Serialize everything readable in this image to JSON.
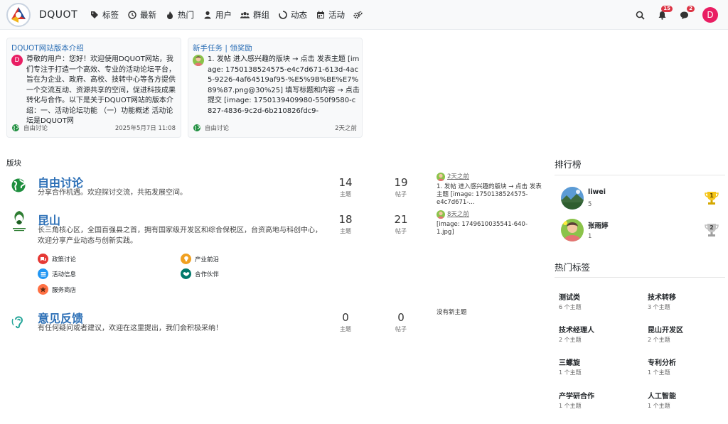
{
  "brand": {
    "name": "DQUOT"
  },
  "nav": {
    "items": [
      {
        "label": "标签",
        "icon": "tags-icon"
      },
      {
        "label": "最新",
        "icon": "clock-icon"
      },
      {
        "label": "热门",
        "icon": "fire-icon"
      },
      {
        "label": "用户",
        "icon": "user-icon"
      },
      {
        "label": "群组",
        "icon": "users-icon"
      },
      {
        "label": "动态",
        "icon": "circle-notch-icon"
      },
      {
        "label": "活动",
        "icon": "calendar-icon"
      },
      {
        "label": "",
        "icon": "cogs-icon"
      }
    ],
    "notifications_count": "15",
    "chat_count": "2",
    "user_initial": "D"
  },
  "cards": [
    {
      "title": "DQUOT网站版本介绍",
      "avatar_initial": "D",
      "text": "尊敬的用户：您好！欢迎使用DQUOT网站，我们专注于打造一个高效、专业的活动论坛平台，旨在为企业、政府、高校、技转中心等各方提供一个交流互动、资源共享的空间，促进科技成果转化与合作。以下是关于DQUOT网站的版本介绍：一、活动论坛功能 （一）功能概述 活动论坛是DQUOT网",
      "category": "自由讨论",
      "time": "2025年5月7日 11:08"
    },
    {
      "title": "新手任务 | 领奖励",
      "text": "1. 发帖 进入感兴趣的版块 → 点击 发表主题 [image: 1750138524575-e4c7d671-613d-4ac5-9226-4af64519af95-%E5%9B%BE%E7%89%87.png@30%25] 填写标题和内容 → 点击 提交 [image: 1750139409980-550f9580-c827-4836-9c2d-6b210826fdc9-",
      "category": "自由讨论",
      "time": "2天之前"
    }
  ],
  "categories_label": "版块",
  "categories": [
    {
      "name": "自由讨论",
      "desc": "分享合作机遇。欢迎探讨交流，共拓发展空间。",
      "topics": "14",
      "posts": "19",
      "topics_label": "主题",
      "posts_label": "帖子",
      "latest_time": "2天之前",
      "latest_text": "1. 发帖 进入感兴趣的版块 → 点击 发表主题 [image: 1750138524575-e4c7d671-..."
    },
    {
      "name": "昆山",
      "desc": "长三角核心区，全国百强县之首，拥有国家级开发区和综合保税区，台资高地与科创中心，欢迎分享产业动态与创新实践。",
      "topics": "18",
      "posts": "21",
      "topics_label": "主题",
      "posts_label": "帖子",
      "latest_time": "8天之前",
      "latest_text": "[image: 1749610035541-640-1.jpg]",
      "subcategories": [
        {
          "label": "政策讨论",
          "color": "#e53935"
        },
        {
          "label": "产业前沿",
          "color": "#f0a020"
        },
        {
          "label": "活动信息",
          "color": "#2196f3"
        },
        {
          "label": "合作伙伴",
          "color": "#00796b"
        },
        {
          "label": "服务商店",
          "color": "#ff7043"
        }
      ]
    },
    {
      "name": "意见反馈",
      "desc": "有任何疑问或者建议，欢迎在这里提出，我们会积极采纳！",
      "topics": "0",
      "posts": "0",
      "topics_label": "主题",
      "posts_label": "帖子",
      "latest_text": "没有新主题"
    }
  ],
  "leaderboard": {
    "title": "排行榜",
    "entries": [
      {
        "name": "liwei",
        "score": "5",
        "rank": "1"
      },
      {
        "name": "张雨婷",
        "score": "1",
        "rank": "2"
      }
    ]
  },
  "hot_tags": {
    "title": "热门标签",
    "tags": [
      {
        "name": "测试类",
        "count": "6 个主题"
      },
      {
        "name": "技术转移",
        "count": "3 个主题"
      },
      {
        "name": "技术经理人",
        "count": "2 个主题"
      },
      {
        "name": "昆山开发区",
        "count": "2 个主题"
      },
      {
        "name": "三螺旋",
        "count": "1 个主题"
      },
      {
        "name": "专利分析",
        "count": "1 个主题"
      },
      {
        "name": "产学研合作",
        "count": "1 个主题"
      },
      {
        "name": "人工智能",
        "count": "1 个主题"
      }
    ]
  },
  "colors": {
    "link": "#2c6fb6",
    "badge": "#dc3545",
    "avatar": "#e91e63",
    "gold": "#f5c518",
    "silver": "#b0b0b0"
  }
}
